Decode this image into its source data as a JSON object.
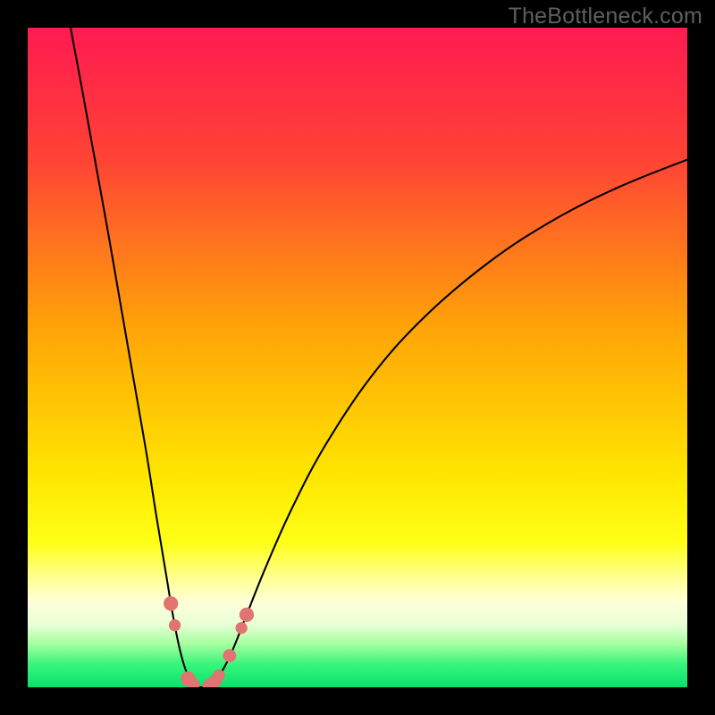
{
  "watermark": "TheBottleneck.com",
  "chart_data": {
    "type": "line",
    "title": "",
    "xlabel": "",
    "ylabel": "",
    "xlim": [
      0,
      100
    ],
    "ylim": [
      0,
      100
    ],
    "gradient_stops": [
      {
        "offset": 0,
        "color": "#ff1a50"
      },
      {
        "offset": 0.2,
        "color": "#ff4335"
      },
      {
        "offset": 0.45,
        "color": "#ffa208"
      },
      {
        "offset": 0.68,
        "color": "#ffe600"
      },
      {
        "offset": 0.78,
        "color": "#ffff16"
      },
      {
        "offset": 0.83,
        "color": "#ffff8a"
      },
      {
        "offset": 0.87,
        "color": "#ffffd8"
      },
      {
        "offset": 0.905,
        "color": "#e8ffd6"
      },
      {
        "offset": 0.935,
        "color": "#a4ff9e"
      },
      {
        "offset": 0.965,
        "color": "#38f57c"
      },
      {
        "offset": 1.0,
        "color": "#06e26b"
      }
    ],
    "series": [
      {
        "name": "left-branch",
        "points": [
          {
            "x": 6.5,
            "y": 100.0
          },
          {
            "x": 8.0,
            "y": 92.0
          },
          {
            "x": 10.0,
            "y": 81.0
          },
          {
            "x": 12.0,
            "y": 70.0
          },
          {
            "x": 14.0,
            "y": 58.5
          },
          {
            "x": 16.0,
            "y": 47.0
          },
          {
            "x": 18.0,
            "y": 35.5
          },
          {
            "x": 19.5,
            "y": 26.0
          },
          {
            "x": 21.0,
            "y": 17.0
          },
          {
            "x": 22.0,
            "y": 11.0
          },
          {
            "x": 23.0,
            "y": 6.0
          },
          {
            "x": 24.0,
            "y": 2.5
          },
          {
            "x": 25.0,
            "y": 0.6
          },
          {
            "x": 26.0,
            "y": 0.0
          }
        ]
      },
      {
        "name": "right-branch",
        "points": [
          {
            "x": 26.0,
            "y": 0.0
          },
          {
            "x": 27.0,
            "y": 0.05
          },
          {
            "x": 28.0,
            "y": 0.5
          },
          {
            "x": 29.5,
            "y": 2.5
          },
          {
            "x": 31.0,
            "y": 5.5
          },
          {
            "x": 33.0,
            "y": 10.5
          },
          {
            "x": 36.0,
            "y": 18.0
          },
          {
            "x": 40.0,
            "y": 27.0
          },
          {
            "x": 45.0,
            "y": 36.5
          },
          {
            "x": 52.0,
            "y": 47.0
          },
          {
            "x": 60.0,
            "y": 56.0
          },
          {
            "x": 70.0,
            "y": 64.5
          },
          {
            "x": 80.0,
            "y": 71.0
          },
          {
            "x": 90.0,
            "y": 76.0
          },
          {
            "x": 100.0,
            "y": 80.0
          }
        ]
      }
    ],
    "markers": [
      {
        "x": 21.7,
        "y": 12.7,
        "r": 1.1
      },
      {
        "x": 22.3,
        "y": 9.4,
        "r": 0.9
      },
      {
        "x": 24.3,
        "y": 1.3,
        "r": 1.1
      },
      {
        "x": 25.1,
        "y": 0.45,
        "r": 1.0
      },
      {
        "x": 27.5,
        "y": 0.25,
        "r": 1.0
      },
      {
        "x": 28.4,
        "y": 0.95,
        "r": 1.0
      },
      {
        "x": 29.0,
        "y": 1.8,
        "r": 0.9
      },
      {
        "x": 30.6,
        "y": 4.8,
        "r": 1.0
      },
      {
        "x": 32.4,
        "y": 9.0,
        "r": 0.9
      },
      {
        "x": 33.2,
        "y": 11.0,
        "r": 1.1
      }
    ]
  }
}
